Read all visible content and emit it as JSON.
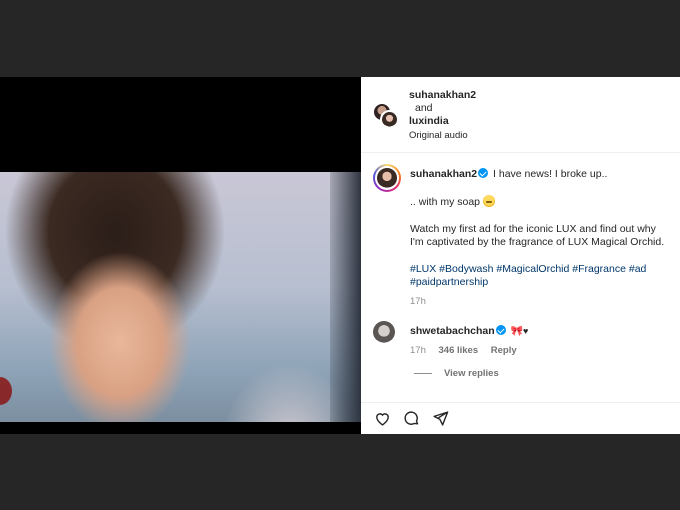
{
  "post": {
    "header": {
      "user1": "suhanakhan2",
      "and": "and",
      "user2": "luxindia",
      "audio": "Original audio"
    },
    "caption": {
      "username": "suhanakhan2",
      "line1": "I have news! I broke up..",
      "line2": ".. with my soap",
      "line3": "Watch my first ad for the iconic LUX and find out why I'm captivated by the fragrance of LUX Magical Orchid.",
      "hashtags": "#LUX #Bodywash #MagicalOrchid #Fragrance #ad #paidpartnership",
      "time": "17h"
    },
    "comment": {
      "username": "shwetabachchan",
      "time": "17h",
      "likes": "346 likes",
      "reply": "Reply",
      "view_replies": "View replies"
    }
  },
  "icons": [
    "mute-icon",
    "verified-icon",
    "heart-icon",
    "comment-icon",
    "share-icon"
  ],
  "colors": {
    "verified": "#0095f6",
    "link": "#00376b",
    "muted_text": "#8e8e8e",
    "backdrop": "#262626"
  }
}
